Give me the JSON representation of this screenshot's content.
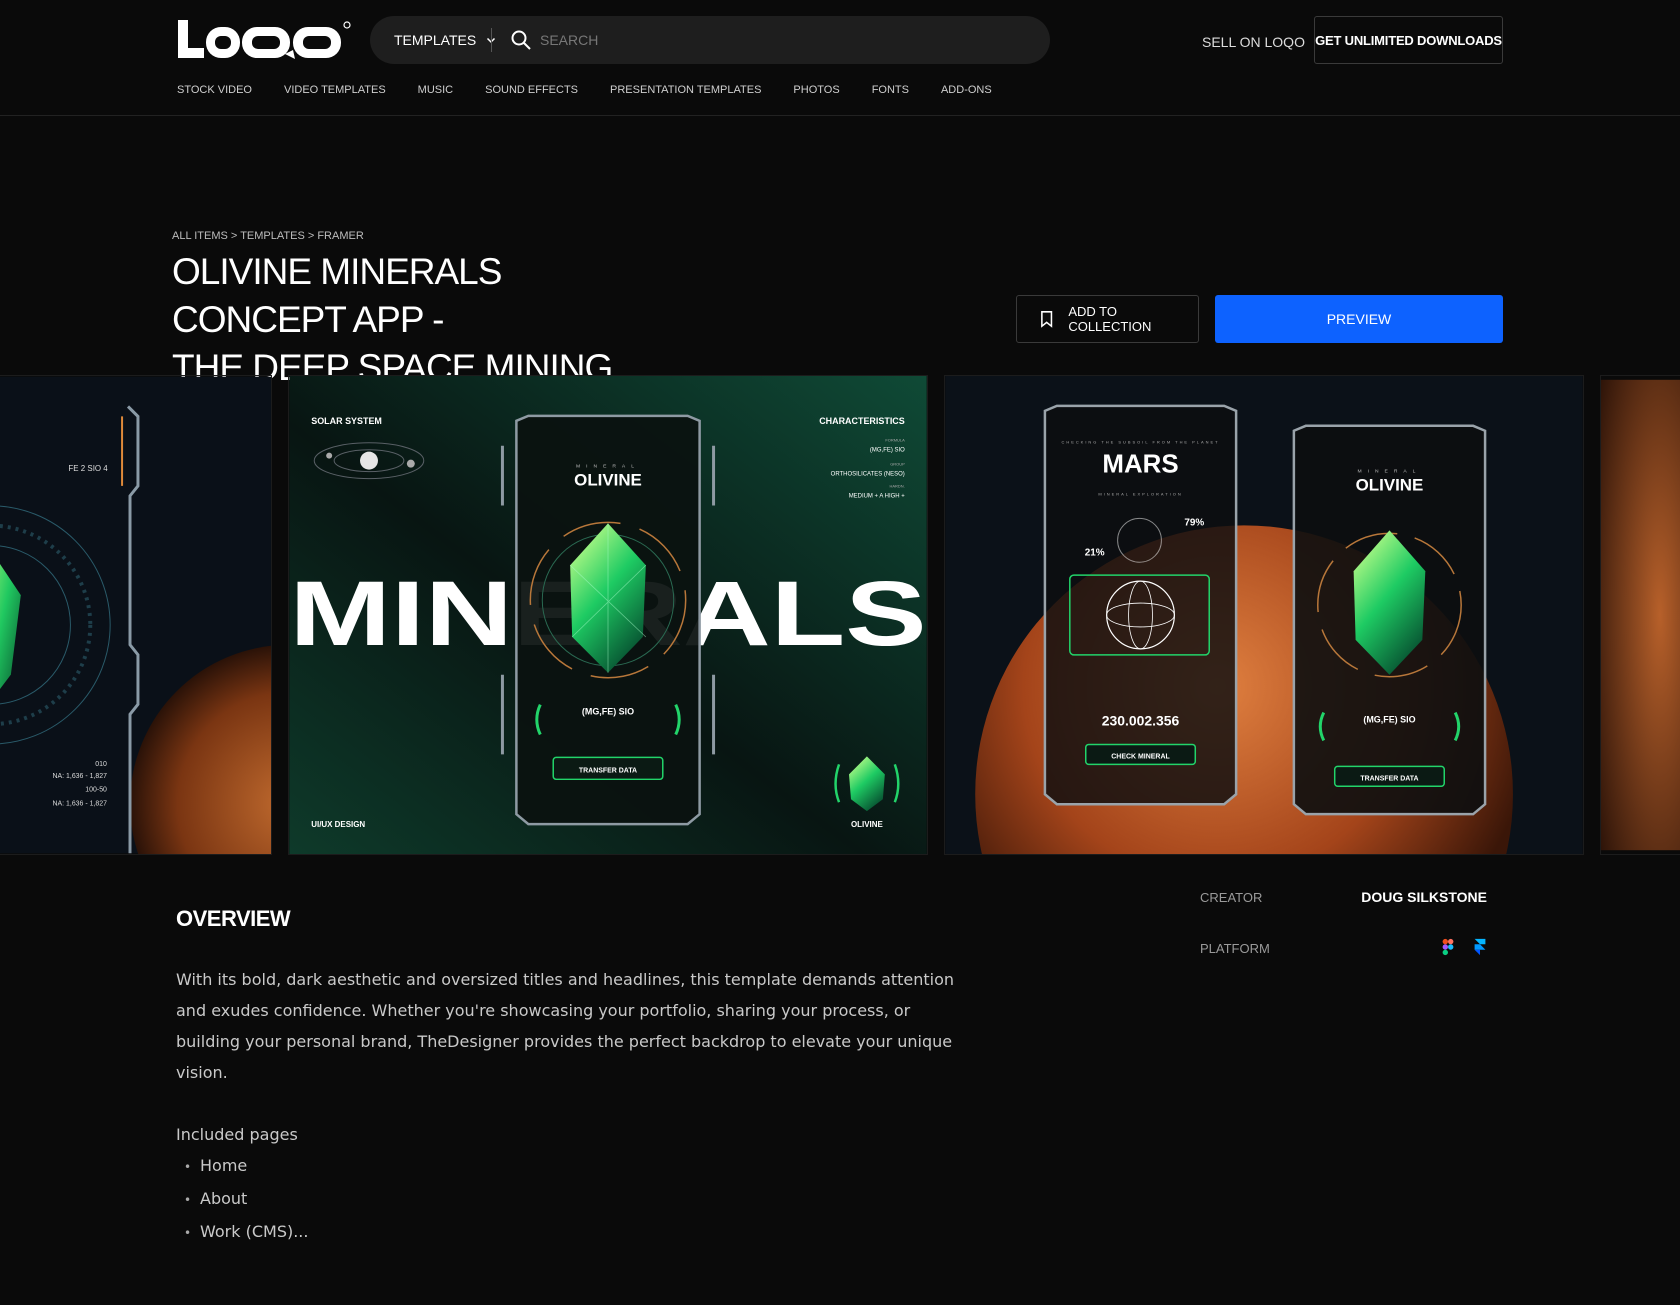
{
  "header": {
    "logo_text": "LOOO",
    "template_select": "TEMPLATES",
    "search_placeholder": "SEARCH",
    "sell_label": "SELL ON LOQO",
    "unlimited_label": "GET UNLIMITED DOWNLOADS",
    "nav": [
      "STOCK VIDEO",
      "VIDEO TEMPLATES",
      "MUSIC",
      "SOUND EFFECTS",
      "PRESENTATION TEMPLATES",
      "PHOTOS",
      "FONTS",
      "ADD-ONS"
    ]
  },
  "breadcrumb": [
    "ALL ITEMS",
    "TEMPLATES",
    "FRAMER"
  ],
  "product": {
    "title_line1": "OLIVINE MINERALS CONCEPT APP -",
    "title_line2": "THE DEEP SPACE MINING CO.",
    "collection_label": "ADD TO COLLECTION",
    "preview_label": "PREVIEW"
  },
  "gallery": {
    "slide1": {
      "text1": "FE 2 SIO 4",
      "text2": "010",
      "text3": "NA: 1,636 - 1,827",
      "text4": "100-50",
      "text5": "NA: 1,636 - 1,827"
    },
    "slide2": {
      "corner_tl": "SOLAR SYSTEM",
      "corner_tr": "CHARACTERISTICS",
      "formula_label": "FORMULA",
      "formula": "(MG,FE) SIO",
      "group_label": "GROUP",
      "group": "ORTHOSILICATES (NESO)",
      "hard_label": "HARDN.",
      "hard": "MEDIUM + A HIGH +",
      "minerals_big": "MINERALS",
      "mineral_sub": "MINERAL",
      "mineral_name": "OLIVINE",
      "formula_card": "(MG,FE) SIO",
      "transfer": "TRANSFER DATA",
      "corner_bl": "UI/UX DESIGN",
      "corner_br": "OLIVINE"
    },
    "slide3": {
      "mars_sub": "CHECKING THE SUBSOIL FROM THE PLANET",
      "mars_title": "MARS",
      "mars_sub2": "MINERAL EXPLORATION",
      "pct1": "79%",
      "pct2": "21%",
      "number": "230.002.356",
      "check": "CHECK MINERAL",
      "mineral_sub": "MINERAL",
      "mineral_name": "OLIVINE",
      "formula_card": "(MG,FE) SIO",
      "transfer": "TRANSFER DATA"
    }
  },
  "overview": {
    "title": "OVERVIEW",
    "body": "With its bold, dark aesthetic and oversized titles and headlines, this template demands attention and exudes confidence. Whether you're showcasing your portfolio, sharing your process, or building your personal brand, TheDesigner provides the perfect backdrop to elevate your unique vision.",
    "pages_heading": "Included pages",
    "pages": [
      "Home",
      "About",
      "Work (CMS)..."
    ]
  },
  "meta": {
    "creator_label": "CREATOR",
    "creator": "DOUG SILKSTONE",
    "platform_label": "PLATFORM",
    "platforms": [
      "figma-icon",
      "framer-icon"
    ]
  },
  "colors": {
    "accent": "#0d62ff",
    "background": "#0a0a0a",
    "mineral_green": "#22d46a",
    "mars_orange": "#c2581f"
  }
}
